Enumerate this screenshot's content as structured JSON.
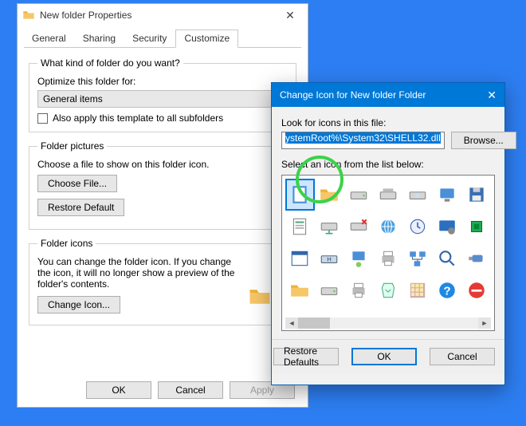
{
  "prop": {
    "title": "New folder Properties",
    "tabs": [
      "General",
      "Sharing",
      "Security",
      "Customize"
    ],
    "active_tab": 3,
    "group1": {
      "legend": "What kind of folder do you want?",
      "label": "Optimize this folder for:",
      "combo_value": "General items",
      "check_label": "Also apply this template to all subfolders"
    },
    "group2": {
      "legend": "Folder pictures",
      "desc": "Choose a file to show on this folder icon.",
      "choose_btn": "Choose File...",
      "restore_btn": "Restore Default"
    },
    "group3": {
      "legend": "Folder icons",
      "desc": "You can change the folder icon. If you change the icon, it will no longer show a preview of the folder's contents.",
      "change_btn": "Change Icon..."
    },
    "ok": "OK",
    "cancel": "Cancel",
    "apply": "Apply"
  },
  "ci": {
    "title": "Change Icon for New folder Folder",
    "look_label": "Look for icons in this file:",
    "path_value": "ystemRoot%\\System32\\SHELL32.dll",
    "browse": "Browse...",
    "select_label": "Select an icon from the list below:",
    "restore": "Restore Defaults",
    "ok": "OK",
    "cancel": "Cancel",
    "icons": [
      "blank-document-icon",
      "folder-icon",
      "drive-icon",
      "drive-open-icon",
      "cd-drive-icon",
      "computer-icon",
      "floppy-icon",
      "page-icon",
      "network-drive-icon",
      "network-drive-x-icon",
      "globe-icon",
      "clock-icon",
      "monitor-settings-icon",
      "chip-icon",
      "window-icon",
      "drive-h-icon",
      "network-pc-icon",
      "printer-icon",
      "network-icon",
      "magnifier-icon",
      "usb-drive-icon",
      "folder2-icon",
      "drive2-icon",
      "printer2-icon",
      "recycle-icon",
      "grid-icon",
      "help-icon",
      "error-icon"
    ],
    "selected_index": 0
  },
  "colors": {
    "bg": "#2d7ef2",
    "accent": "#0078d7",
    "highlight": "#3bd24a"
  }
}
